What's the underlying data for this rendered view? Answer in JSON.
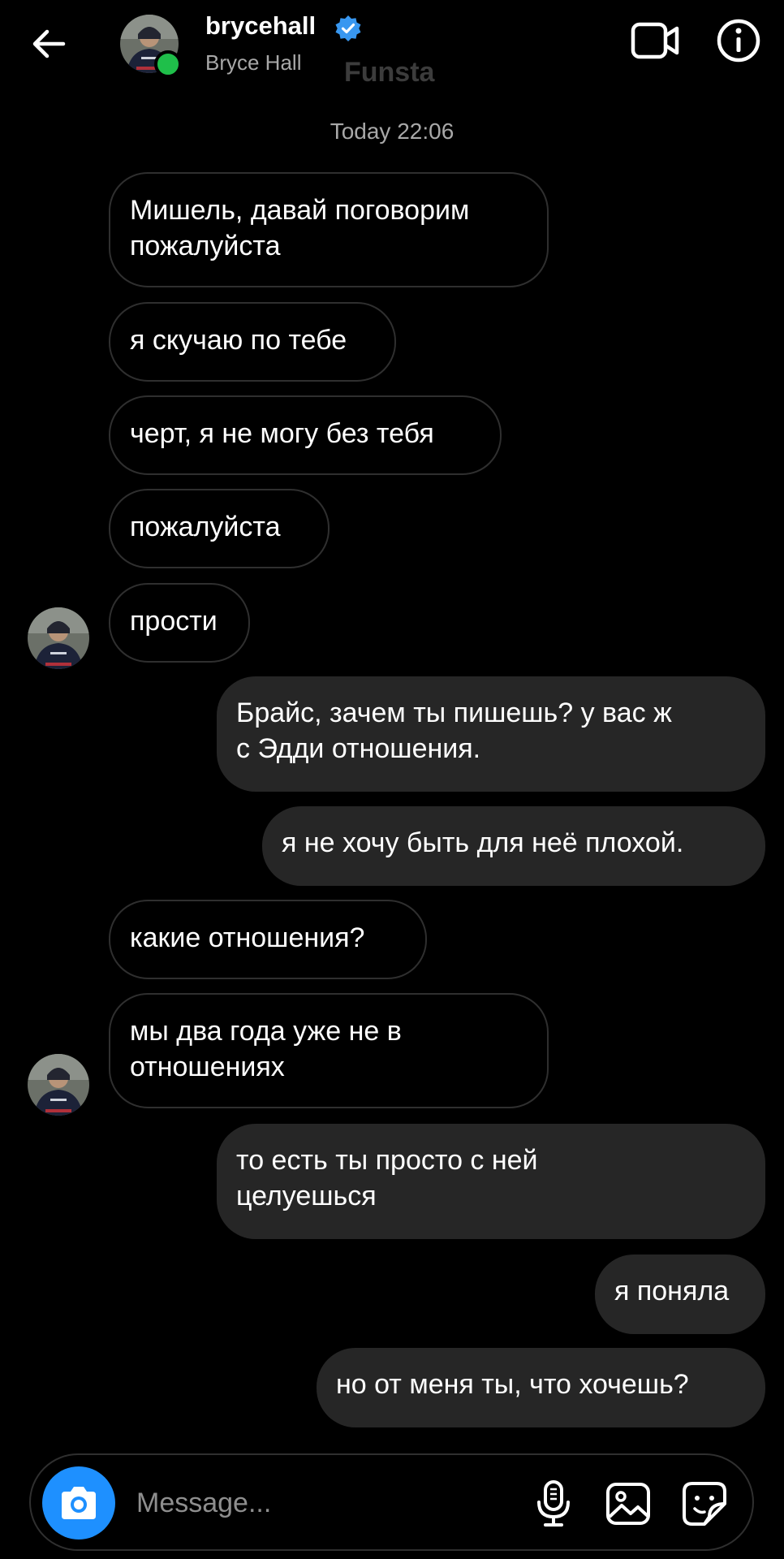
{
  "header": {
    "username": "brycehall",
    "full_name": "Bryce Hall",
    "overlay_label": "Funsta",
    "verified": true,
    "online": true,
    "icons": {
      "back": "arrow-left-icon",
      "video": "video-camera-icon",
      "info": "info-icon",
      "verified": "verified-badge-icon"
    }
  },
  "thread": {
    "timestamp": "Today 22:06",
    "messages": [
      {
        "direction": "incoming",
        "text": "Мишель, давай поговорим\nпожалуйста"
      },
      {
        "direction": "incoming",
        "text": "я скучаю по тебе"
      },
      {
        "direction": "incoming",
        "text": "черт, я не могу без тебя"
      },
      {
        "direction": "incoming",
        "text": "пожалуйста"
      },
      {
        "direction": "incoming",
        "text": "прости",
        "avatar": true
      },
      {
        "direction": "outgoing",
        "text": "Брайс, зачем ты пишешь? у вас ж\nс Эдди отношения."
      },
      {
        "direction": "outgoing",
        "text": "я не хочу быть для неё плохой."
      },
      {
        "direction": "incoming",
        "text": "какие отношения?"
      },
      {
        "direction": "incoming",
        "text": "мы два года уже не в\nотношениях",
        "avatar": true
      },
      {
        "direction": "outgoing",
        "text": "то есть ты просто с ней\nцелуешься"
      },
      {
        "direction": "outgoing",
        "text": "я поняла"
      },
      {
        "direction": "outgoing",
        "text": "но от меня ты, что хочешь?"
      }
    ]
  },
  "composer": {
    "placeholder": "Message...",
    "icons": {
      "camera": "camera-icon",
      "mic": "microphone-icon",
      "gallery": "image-icon",
      "sticker": "sticker-icon"
    }
  },
  "colors": {
    "background": "#000000",
    "outgoing_bubble": "#262626",
    "incoming_border": "#2f2f2f",
    "accent": "#1e90ff",
    "online": "#1fbf4a",
    "verified": "#3897f0"
  }
}
